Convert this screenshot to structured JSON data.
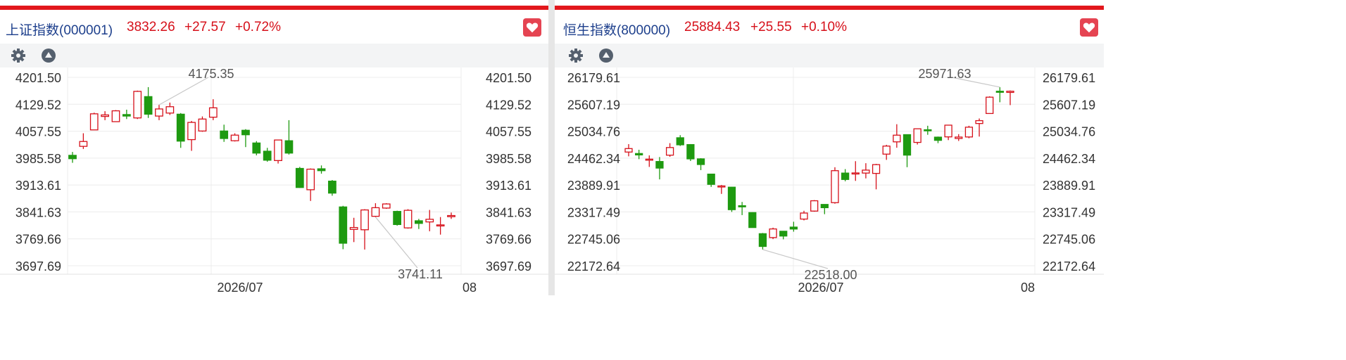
{
  "panels": [
    {
      "index_name": "上证指数(000001)",
      "price": "3832.26",
      "change": "+27.57",
      "change_pct": "+0.72%"
    },
    {
      "index_name": "恒生指数(800000)",
      "price": "25884.43",
      "change": "+25.55",
      "change_pct": "+0.10%"
    }
  ],
  "colors": {
    "up": "#d6101a",
    "down": "#1e9a10",
    "accent": "#e2171c",
    "title": "#1d3f8c",
    "favorite": "#e54452"
  },
  "icons": [
    "gear-icon",
    "triangle-up-icon",
    "heart-icon"
  ],
  "chart_data": [
    {
      "type": "candlestick",
      "y_ticks": [
        "4201.50",
        "4129.52",
        "4057.55",
        "3985.58",
        "3913.61",
        "3841.63",
        "3769.66",
        "3697.69"
      ],
      "ylim": [
        3697.69,
        4201.5
      ],
      "x_ticks": [
        "2026/07",
        "08"
      ],
      "annotations": [
        {
          "label": "4175.35",
          "candle": 8
        },
        {
          "label": "3741.11",
          "candle": 28
        }
      ],
      "candles": [
        {
          "o": 3993,
          "c": 3984,
          "h": 4002,
          "l": 3973
        },
        {
          "o": 4017,
          "c": 4030,
          "h": 4052,
          "l": 4010
        },
        {
          "o": 4061,
          "c": 4104,
          "h": 4107,
          "l": 4061
        },
        {
          "o": 4097,
          "c": 4101,
          "h": 4111,
          "l": 4087
        },
        {
          "o": 4083,
          "c": 4112,
          "h": 4114,
          "l": 4083
        },
        {
          "o": 4102,
          "c": 4098,
          "h": 4115,
          "l": 4090
        },
        {
          "o": 4093,
          "c": 4164,
          "h": 4166,
          "l": 4090
        },
        {
          "o": 4150,
          "c": 4103,
          "h": 4175.35,
          "l": 4093
        },
        {
          "o": 4098,
          "c": 4117,
          "h": 4128,
          "l": 4087
        },
        {
          "o": 4106,
          "c": 4123,
          "h": 4134,
          "l": 4101
        },
        {
          "o": 4103,
          "c": 4031,
          "h": 4106,
          "l": 4013
        },
        {
          "o": 4035,
          "c": 4081,
          "h": 4085,
          "l": 4005
        },
        {
          "o": 4058,
          "c": 4090,
          "h": 4097,
          "l": 4056
        },
        {
          "o": 4095,
          "c": 4120,
          "h": 4143,
          "l": 4087
        },
        {
          "o": 4058,
          "c": 4038,
          "h": 4075,
          "l": 4029
        },
        {
          "o": 4032,
          "c": 4047,
          "h": 4052,
          "l": 4030
        },
        {
          "o": 4060,
          "c": 4048,
          "h": 4063,
          "l": 4015
        },
        {
          "o": 4026,
          "c": 3999,
          "h": 4031,
          "l": 3993
        },
        {
          "o": 4004,
          "c": 3980,
          "h": 4013,
          "l": 3976
        },
        {
          "o": 3979,
          "c": 4034,
          "h": 4035,
          "l": 3971
        },
        {
          "o": 4032,
          "c": 3999,
          "h": 4087,
          "l": 3995
        },
        {
          "o": 3958,
          "c": 3907,
          "h": 3962,
          "l": 3906
        },
        {
          "o": 3901,
          "c": 3956,
          "h": 3958,
          "l": 3871
        },
        {
          "o": 3957,
          "c": 3952,
          "h": 3966,
          "l": 3944
        },
        {
          "o": 3924,
          "c": 3892,
          "h": 3927,
          "l": 3885
        },
        {
          "o": 3855,
          "c": 3758,
          "h": 3858,
          "l": 3742
        },
        {
          "o": 3795,
          "c": 3800,
          "h": 3826,
          "l": 3761
        },
        {
          "o": 3794,
          "c": 3847,
          "h": 3849,
          "l": 3741.11
        },
        {
          "o": 3830,
          "c": 3853,
          "h": 3865,
          "l": 3828
        },
        {
          "o": 3852,
          "c": 3863,
          "h": 3865,
          "l": 3850
        },
        {
          "o": 3843,
          "c": 3808,
          "h": 3845,
          "l": 3805
        },
        {
          "o": 3799,
          "c": 3846,
          "h": 3849,
          "l": 3797
        },
        {
          "o": 3818,
          "c": 3811,
          "h": 3823,
          "l": 3796
        },
        {
          "o": 3815,
          "c": 3822,
          "h": 3847,
          "l": 3790
        },
        {
          "o": 3807,
          "c": 3807,
          "h": 3828,
          "l": 3781
        },
        {
          "o": 3829,
          "c": 3832,
          "h": 3840,
          "l": 3823
        }
      ]
    },
    {
      "type": "candlestick",
      "y_ticks": [
        "26179.61",
        "25607.19",
        "25034.76",
        "24462.34",
        "23889.91",
        "23317.49",
        "22745.06",
        "22172.64"
      ],
      "ylim": [
        22172.64,
        26179.61
      ],
      "x_ticks": [
        "2026/07",
        "08"
      ],
      "annotations": [
        {
          "label": "25971.63",
          "candle": 36
        },
        {
          "label": "22518.00",
          "candle": 13
        }
      ],
      "candles": [
        {
          "o": 24591,
          "c": 24665,
          "h": 24760,
          "l": 24500
        },
        {
          "o": 24560,
          "c": 24530,
          "h": 24640,
          "l": 24440
        },
        {
          "o": 24430,
          "c": 24440,
          "h": 24520,
          "l": 24275
        },
        {
          "o": 24390,
          "c": 24250,
          "h": 24485,
          "l": 24010
        },
        {
          "o": 24525,
          "c": 24687,
          "h": 24780,
          "l": 24490
        },
        {
          "o": 24895,
          "c": 24745,
          "h": 24950,
          "l": 24720
        },
        {
          "o": 24750,
          "c": 24446,
          "h": 24760,
          "l": 24400
        },
        {
          "o": 24446,
          "c": 24326,
          "h": 24460,
          "l": 24207
        },
        {
          "o": 24122,
          "c": 23904,
          "h": 24130,
          "l": 23850
        },
        {
          "o": 23862,
          "c": 23870,
          "h": 23890,
          "l": 23701
        },
        {
          "o": 23844,
          "c": 23366,
          "h": 23850,
          "l": 23318
        },
        {
          "o": 23450,
          "c": 23426,
          "h": 23530,
          "l": 23250
        },
        {
          "o": 23304,
          "c": 22986,
          "h": 23310,
          "l": 22980
        },
        {
          "o": 22855,
          "c": 22584,
          "h": 22870,
          "l": 22518
        },
        {
          "o": 22773,
          "c": 22956,
          "h": 22983,
          "l": 22740
        },
        {
          "o": 22907,
          "c": 22805,
          "h": 22913,
          "l": 22735
        },
        {
          "o": 22995,
          "c": 22954,
          "h": 23109,
          "l": 22898
        },
        {
          "o": 23166,
          "c": 23294,
          "h": 23342,
          "l": 23138
        },
        {
          "o": 23336,
          "c": 23555,
          "h": 23569,
          "l": 23323
        },
        {
          "o": 23477,
          "c": 23408,
          "h": 23480,
          "l": 23270
        },
        {
          "o": 23515,
          "c": 24195,
          "h": 24268,
          "l": 23493
        },
        {
          "o": 24144,
          "c": 24008,
          "h": 24228,
          "l": 23970
        },
        {
          "o": 24143,
          "c": 24147,
          "h": 24397,
          "l": 23978
        },
        {
          "o": 24144,
          "c": 24207,
          "h": 24354,
          "l": 24031
        },
        {
          "o": 24137,
          "c": 24324,
          "h": 24340,
          "l": 23798
        },
        {
          "o": 24547,
          "c": 24718,
          "h": 24745,
          "l": 24425
        },
        {
          "o": 24808,
          "c": 24950,
          "h": 25183,
          "l": 24683
        },
        {
          "o": 24961,
          "c": 24526,
          "h": 24963,
          "l": 24269
        },
        {
          "o": 24796,
          "c": 25086,
          "h": 25092,
          "l": 24751
        },
        {
          "o": 25065,
          "c": 25045,
          "h": 25150,
          "l": 24958
        },
        {
          "o": 24908,
          "c": 24840,
          "h": 24920,
          "l": 24780
        },
        {
          "o": 24914,
          "c": 25163,
          "h": 25169,
          "l": 24845
        },
        {
          "o": 24880,
          "c": 24910,
          "h": 24972,
          "l": 24827
        },
        {
          "o": 24912,
          "c": 25120,
          "h": 25150,
          "l": 24885
        },
        {
          "o": 25198,
          "c": 25259,
          "h": 25305,
          "l": 24920
        },
        {
          "o": 25411,
          "c": 25758,
          "h": 25775,
          "l": 25405
        },
        {
          "o": 25884,
          "c": 25869,
          "h": 25971.63,
          "l": 25650
        },
        {
          "o": 25859,
          "c": 25884.43,
          "h": 25900,
          "l": 25589
        }
      ]
    }
  ]
}
